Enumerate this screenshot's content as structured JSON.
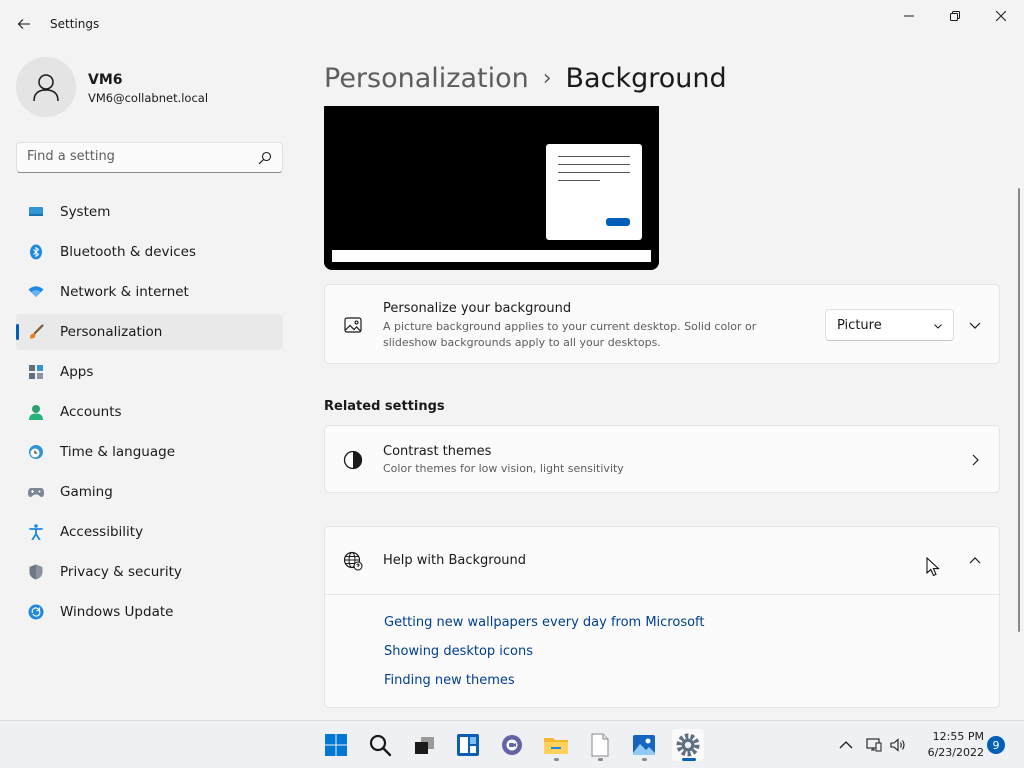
{
  "window": {
    "title": "Settings"
  },
  "user": {
    "name": "VM6",
    "email": "VM6@collabnet.local"
  },
  "search": {
    "placeholder": "Find a setting"
  },
  "sidebar": {
    "items": [
      {
        "label": "System",
        "icon": "system-icon"
      },
      {
        "label": "Bluetooth & devices",
        "icon": "bluetooth-icon"
      },
      {
        "label": "Network & internet",
        "icon": "wifi-icon"
      },
      {
        "label": "Personalization",
        "icon": "brush-icon",
        "active": true
      },
      {
        "label": "Apps",
        "icon": "apps-icon"
      },
      {
        "label": "Accounts",
        "icon": "accounts-icon"
      },
      {
        "label": "Time & language",
        "icon": "clock-globe-icon"
      },
      {
        "label": "Gaming",
        "icon": "gamepad-icon"
      },
      {
        "label": "Accessibility",
        "icon": "accessibility-icon"
      },
      {
        "label": "Privacy & security",
        "icon": "shield-icon"
      },
      {
        "label": "Windows Update",
        "icon": "update-icon"
      }
    ]
  },
  "header": {
    "parent": "Personalization",
    "separator": "›",
    "current": "Background"
  },
  "personalize": {
    "title": "Personalize your background",
    "description_line1": "A picture background applies to your current desktop. Solid color or",
    "description_line2": "slideshow backgrounds apply to all your desktops.",
    "selected": "Picture"
  },
  "related": {
    "section_title": "Related settings",
    "contrast_title": "Contrast themes",
    "contrast_desc": "Color themes for low vision, light sensitivity"
  },
  "help": {
    "title": "Help with Background",
    "links": [
      "Getting new wallpapers every day from Microsoft",
      "Showing desktop icons",
      "Finding new themes"
    ]
  },
  "taskbar": {
    "time": "12:55 PM",
    "date": "6/23/2022",
    "notifications": "9"
  },
  "colors": {
    "accent": "#005fb8",
    "link": "#003e92",
    "background": "#f3f3f3",
    "card": "#fbfbfb"
  }
}
